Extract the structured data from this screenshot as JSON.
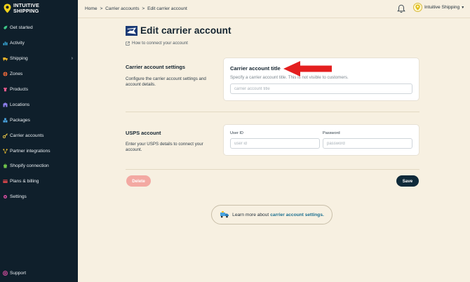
{
  "brand": {
    "line1": "INTUITIVE",
    "line2": "SHIPPING",
    "accent": "#f2d21a"
  },
  "sidebar": {
    "items": [
      {
        "label": "Get started",
        "icon": "rocket-icon"
      },
      {
        "label": "Activity",
        "icon": "activity-icon"
      },
      {
        "label": "Shipping",
        "icon": "shipping-icon",
        "has_submenu": true
      },
      {
        "label": "Zones",
        "icon": "zones-icon"
      },
      {
        "label": "Products",
        "icon": "products-icon"
      },
      {
        "label": "Locations",
        "icon": "locations-icon"
      },
      {
        "label": "Packages",
        "icon": "packages-icon"
      },
      {
        "label": "Carrier accounts",
        "icon": "key-icon"
      },
      {
        "label": "Partner integrations",
        "icon": "integrations-icon"
      },
      {
        "label": "Shopify connection",
        "icon": "shopify-icon"
      },
      {
        "label": "Plans & billing",
        "icon": "billing-icon"
      },
      {
        "label": "Settings",
        "icon": "gear-icon"
      }
    ],
    "support_label": "Support"
  },
  "header": {
    "breadcrumb": [
      "Home",
      ">",
      "Carrier accounts",
      ">",
      "Edit carrier account"
    ],
    "account_name": "Intuitive Shipping"
  },
  "page": {
    "title": "Edit carrier account",
    "howto_link": "How to connect your account"
  },
  "settings_section": {
    "title": "Carrier account settings",
    "description": "Configure the carrier account settings and account details.",
    "card_title": "Carrier account title",
    "card_help": "Specify a carrier account title. This is not visible to customers.",
    "title_placeholder": "carrier account title"
  },
  "usps_section": {
    "title": "USPS account",
    "description": "Enter your USPS details to connect your account.",
    "user_id_label": "User ID",
    "user_id_placeholder": "user id",
    "password_label": "Password",
    "password_placeholder": "password"
  },
  "actions": {
    "delete_label": "Delete",
    "save_label": "Save"
  },
  "learn_more": {
    "prefix": "Learn more about",
    "link": "carrier account settings."
  },
  "colors": {
    "sidebar_bg": "#0f1f2b",
    "page_bg": "#f7f0e1",
    "save_bg": "#0f2a3a",
    "delete_bg": "#f3a9a2",
    "arrow": "#e41f1f"
  }
}
